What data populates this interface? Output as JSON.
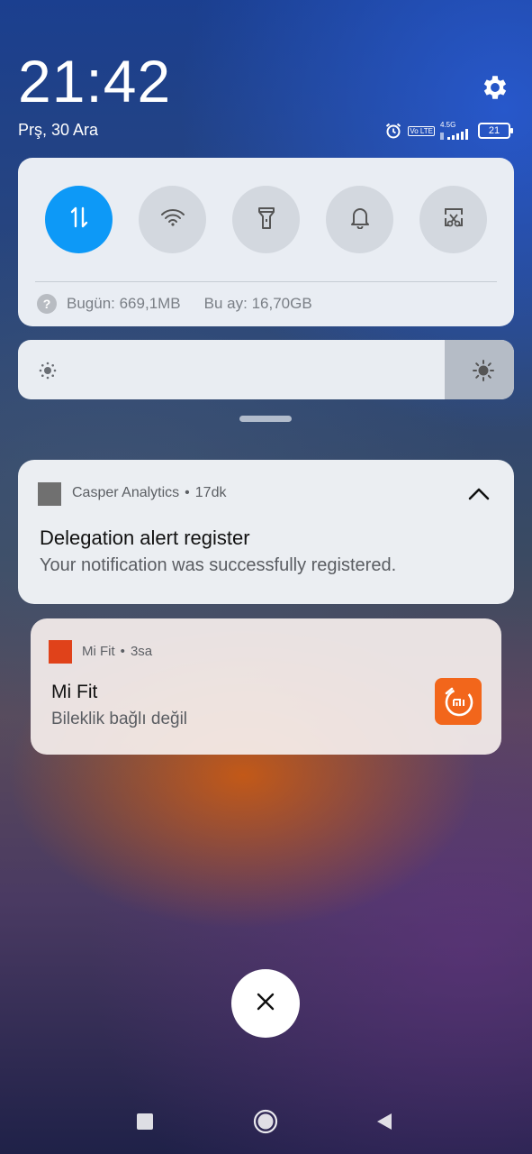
{
  "status_bar": {
    "time": "21:42",
    "date": "Prş, 30 Ara",
    "icons": [
      "alarm-icon",
      "volte-icon",
      "signal-4.5g-icon"
    ],
    "volte_label": "Vo LTE",
    "network_label": "4.5G",
    "battery": "21"
  },
  "quick_settings": {
    "toggles": [
      {
        "name": "mobile-data",
        "icon": "data-arrows-icon",
        "active": true
      },
      {
        "name": "wifi",
        "icon": "wifi-icon",
        "active": false
      },
      {
        "name": "flashlight",
        "icon": "flashlight-icon",
        "active": false
      },
      {
        "name": "sound",
        "icon": "bell-icon",
        "active": false
      },
      {
        "name": "screenshot",
        "icon": "screenshot-icon",
        "active": false
      }
    ],
    "usage": {
      "today": "Bugün: 669,1MB",
      "month": "Bu ay: 16,70GB"
    },
    "brightness": 0.86
  },
  "notifications": [
    {
      "app": "Casper Analytics",
      "time": "17dk",
      "title": "Delegation alert register",
      "text": "Your notification was successfully registered."
    },
    {
      "app": "Mi Fit",
      "time": "3sa",
      "title": "Mi Fit",
      "text": "Bileklik bağlı değil"
    }
  ],
  "colors": {
    "accent": "#0d99f7",
    "mifit": "#f2661b"
  }
}
